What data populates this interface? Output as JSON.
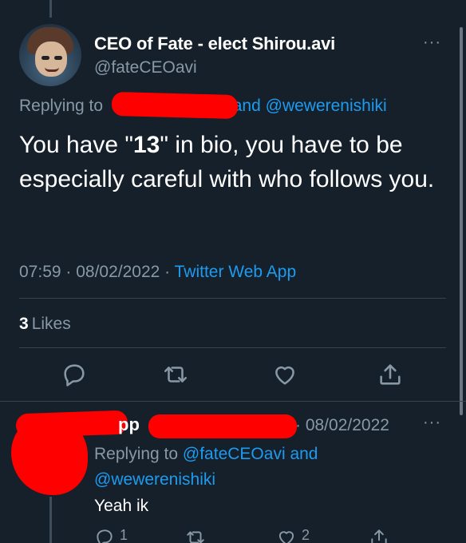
{
  "tweet": {
    "display_name": "CEO of Fate - elect Shirou.avi",
    "handle": "@fateCEOavi",
    "more": "···",
    "replying_prefix": "Replying to",
    "replying_rest": "and @wewerenishiki",
    "text_1": "You have \"",
    "text_bold": "13",
    "text_2": "\" in bio, you have to be especially careful with who follows you.",
    "time": "07:59 · 08/02/2022 · ",
    "source": "Twitter Web App",
    "likes_count": "3",
    "likes_label": "Likes"
  },
  "reply": {
    "name_fragment": "pp",
    "date": "· 08/02/2022",
    "more": "···",
    "replying_prefix": "Replying to",
    "replying_mention_1": "@fateCEOavi",
    "replying_and": "and",
    "replying_mention_2": "@wewerenishiki",
    "text": "Yeah ik",
    "reply_count": "1",
    "like_count": "2"
  },
  "icons": [
    "reply-icon",
    "retweet-icon",
    "like-icon",
    "share-icon",
    "more-icon"
  ],
  "colors": {
    "background": "#15202b",
    "secondary_text": "#8899a6",
    "accent": "#1d9bf0",
    "redaction": "#ff0000",
    "divider": "#38444d"
  }
}
